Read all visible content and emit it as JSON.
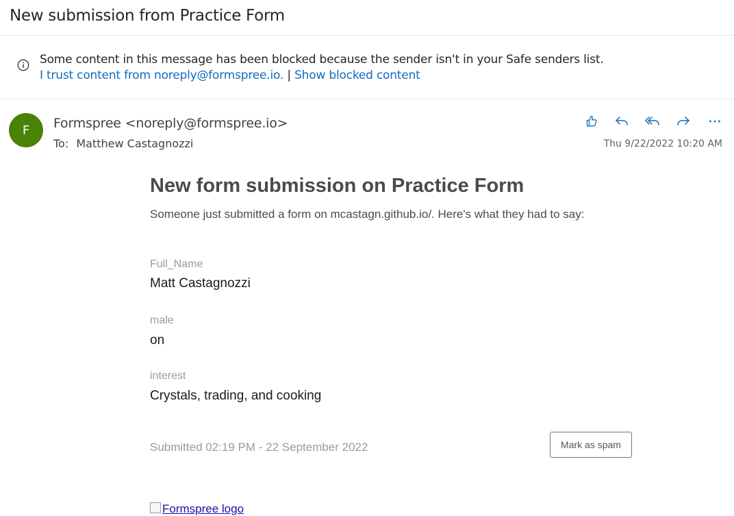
{
  "subject": "New submission from Practice Form",
  "banner": {
    "message": "Some content in this message has been blocked because the sender isn't in your Safe senders list.",
    "trust_link": "I trust content from noreply@formspree.io.",
    "separator": "|",
    "show_link": "Show blocked content"
  },
  "sender": {
    "initial": "F",
    "display": "Formspree <noreply@formspree.io>",
    "to_label": "To:",
    "to_name": "Matthew Castagnozzi",
    "date": "Thu 9/22/2022 10:20 AM",
    "avatar_color": "#498205"
  },
  "actions": [
    "like-icon",
    "reply-icon",
    "reply-all-icon",
    "forward-icon",
    "more-icon"
  ],
  "body": {
    "heading": "New form submission on Practice Form",
    "intro": "Someone just submitted a form on mcastagn.github.io/. Here's what they had to say:",
    "fields": [
      {
        "label": "Full_Name",
        "value": "Matt Castagnozzi"
      },
      {
        "label": "male",
        "value": "on"
      },
      {
        "label": "interest",
        "value": "Crystals, trading, and cooking"
      }
    ],
    "submitted": "Submitted 02:19 PM - 22 September 2022",
    "spam_button": "Mark as spam",
    "logo_alt": "Formspree logo"
  },
  "colors": {
    "link": "#0f6cbd",
    "accent_icons": "#0f6cbd"
  }
}
